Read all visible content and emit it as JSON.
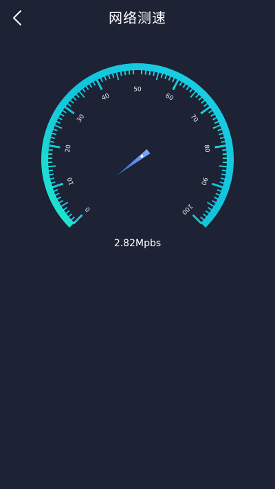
{
  "header": {
    "title": "网络测速",
    "back_icon": "chevron-left-icon"
  },
  "gauge": {
    "min": 0,
    "max": 100,
    "current_value": 2.82,
    "unit": "Mpbs",
    "tick_labels": [
      "0",
      "10",
      "20",
      "30",
      "40",
      "50",
      "60",
      "70",
      "80",
      "90",
      "100"
    ],
    "colors": {
      "arc_start": "#20e8cf",
      "arc_mid": "#12c3db",
      "arc_end": "#1bd0e6",
      "needle": "#4a88ee",
      "needle_tip": "#9cc4ff",
      "background": "#1d2234"
    }
  },
  "readout": {
    "text": "2.82Mpbs"
  }
}
